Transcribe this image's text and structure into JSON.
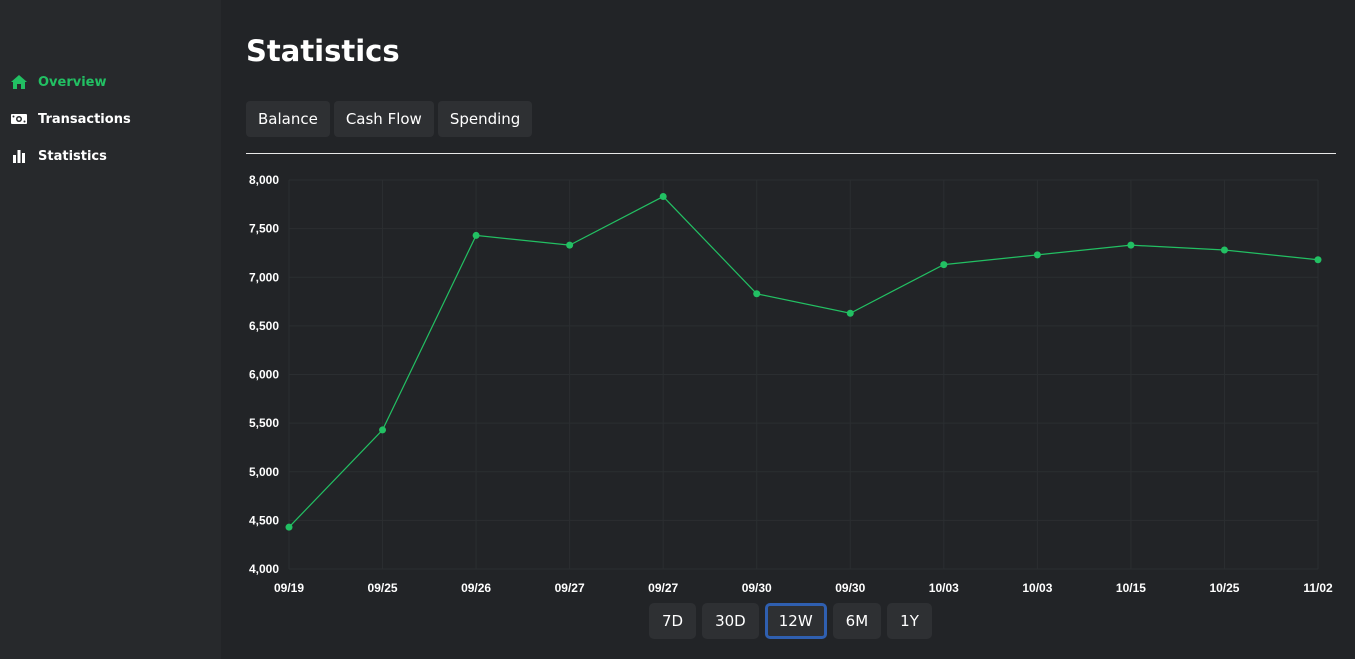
{
  "sidebar": {
    "items": [
      {
        "label": "Overview",
        "icon": "home-icon",
        "active": true
      },
      {
        "label": "Transactions",
        "icon": "money-icon",
        "active": false
      },
      {
        "label": "Statistics",
        "icon": "bar-chart-icon",
        "active": false
      }
    ]
  },
  "main": {
    "title": "Statistics",
    "tabs": [
      {
        "label": "Balance"
      },
      {
        "label": "Cash Flow"
      },
      {
        "label": "Spending"
      }
    ],
    "ranges": [
      {
        "label": "7D",
        "selected": false
      },
      {
        "label": "30D",
        "selected": false
      },
      {
        "label": "12W",
        "selected": true
      },
      {
        "label": "6M",
        "selected": false
      },
      {
        "label": "1Y",
        "selected": false
      }
    ]
  },
  "colors": {
    "accent": "#22c063",
    "background": "#222427",
    "sidebar": "#27292c",
    "button": "#2e3033",
    "selected_border": "#2f5fb0"
  },
  "chart_data": {
    "type": "line",
    "categories": [
      "09/19",
      "09/25",
      "09/26",
      "09/27",
      "09/27",
      "09/30",
      "09/30",
      "10/03",
      "10/03",
      "10/15",
      "10/25",
      "11/02"
    ],
    "series": [
      {
        "values": [
          4430,
          5430,
          7430,
          7330,
          7830,
          6830,
          6630,
          7130,
          7230,
          7330,
          7280,
          7180
        ]
      }
    ],
    "ylim": [
      4000,
      8000
    ],
    "yticks": [
      4000,
      4500,
      5000,
      5500,
      6000,
      6500,
      7000,
      7500,
      8000
    ],
    "ytick_labels": [
      "4,000",
      "4,500",
      "5,000",
      "5,500",
      "6,000",
      "6,500",
      "7,000",
      "7,500",
      "8,000"
    ],
    "grid": true,
    "line_color": "#22c063"
  }
}
